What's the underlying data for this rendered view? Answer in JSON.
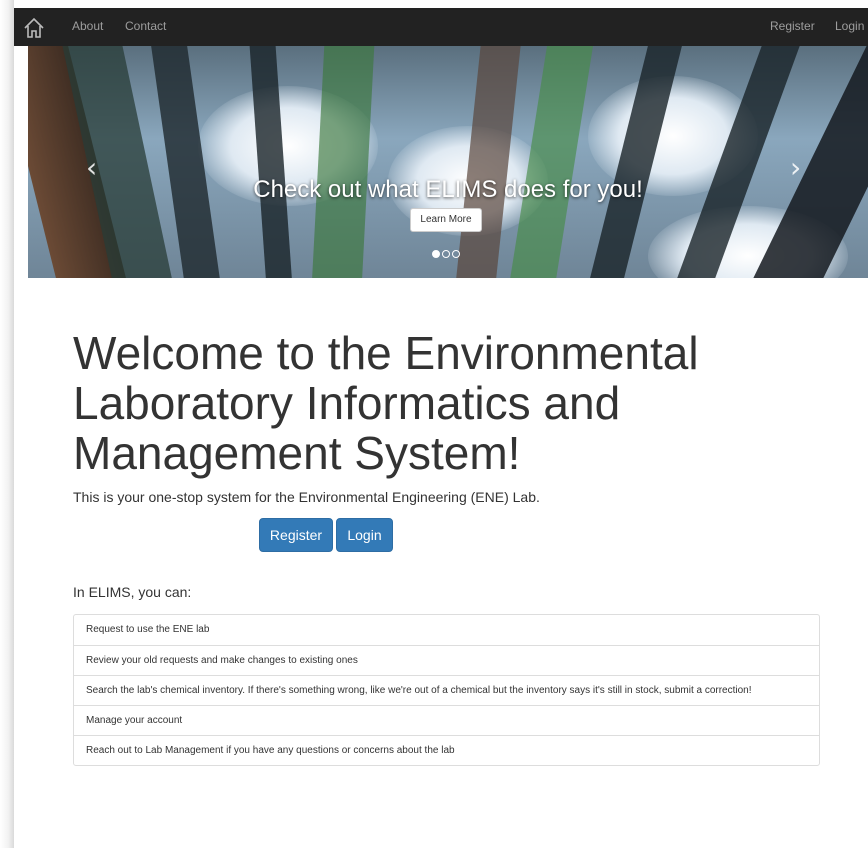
{
  "navbar": {
    "home_icon": "home-icon",
    "about": "About",
    "contact": "Contact",
    "register": "Register",
    "login": "Login"
  },
  "carousel": {
    "caption": "Check out what ELIMS does for you!",
    "button": "Learn More",
    "slides": 3,
    "active_slide": 1,
    "prev_icon": "chevron-left-icon",
    "next_icon": "chevron-right-icon"
  },
  "main": {
    "heading": "Welcome to the Environmental Laboratory Informatics and Management System!",
    "subtext": "This is your one-stop system for the Environmental Engineering (ENE) Lab.",
    "register_button": "Register",
    "login_button": "Login"
  },
  "features": {
    "title": "In ELIMS, you can:",
    "items": [
      "Request to use the ENE lab",
      "Review your old requests and make changes to existing ones",
      "Search the lab's chemical inventory. If there's something wrong, like we're out of a chemical but the inventory says it's still in stock, submit a correction!",
      "Manage your account",
      "Reach out to Lab Management if you have any questions or concerns about the lab"
    ]
  },
  "colors": {
    "navbar": "#222222",
    "nav_text": "#9d9d9d",
    "primary": "#337ab7"
  }
}
